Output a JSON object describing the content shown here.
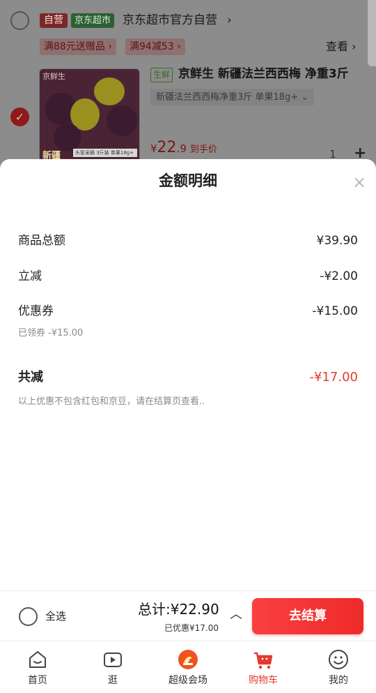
{
  "shop": {
    "self_tag": "自营",
    "super_tag": "京东超市",
    "name": "京东超市官方自营",
    "arrow": "›",
    "promos": [
      "满88元送赠品 ›",
      "满94减53 ›"
    ],
    "see_label": "查看 ›"
  },
  "item": {
    "brand_text": "京鲜生",
    "image_label": "新疆",
    "image_strip": "头筐采摘 3斤装 单果18g+",
    "fresh_tag": "生鲜",
    "title": "京鲜生 新疆法兰西西梅 净重3斤",
    "spec": "新疆法兰西西梅净重3斤 单果18g+ ⌄",
    "price_symbol": "¥",
    "price_int": "22",
    "price_dec": ".9",
    "price_note": "到手价",
    "quantity": "1",
    "plus": "+"
  },
  "sheet": {
    "title": "金额明细",
    "close": "×",
    "rows": [
      {
        "label": "商品总额",
        "value": "¥39.90"
      },
      {
        "label": "立减",
        "value": "-¥2.00"
      },
      {
        "label": "优惠券",
        "value": "-¥15.00"
      }
    ],
    "coupon_note": "已领券 -¥15.00",
    "total_label": "共减",
    "total_value": "-¥17.00",
    "disclaimer": "以上优惠不包含红包和京豆，请在结算页查看.."
  },
  "checkout": {
    "select_all": "全选",
    "total": "总计:¥22.90",
    "saved": "已优惠¥17.00",
    "caret": "︿",
    "pay_button": "去结算"
  },
  "tabs": [
    {
      "label": "首页",
      "icon": "home-icon"
    },
    {
      "label": "逛",
      "icon": "video-icon"
    },
    {
      "label": "超级会场",
      "icon": "super-venue-icon"
    },
    {
      "label": "购物车",
      "icon": "cart-icon",
      "active": true
    },
    {
      "label": "我的",
      "icon": "profile-icon"
    }
  ],
  "colors": {
    "accent": "#e53a2c",
    "pay_button": "#f33a3a",
    "overlay": "#8c8c8c"
  }
}
